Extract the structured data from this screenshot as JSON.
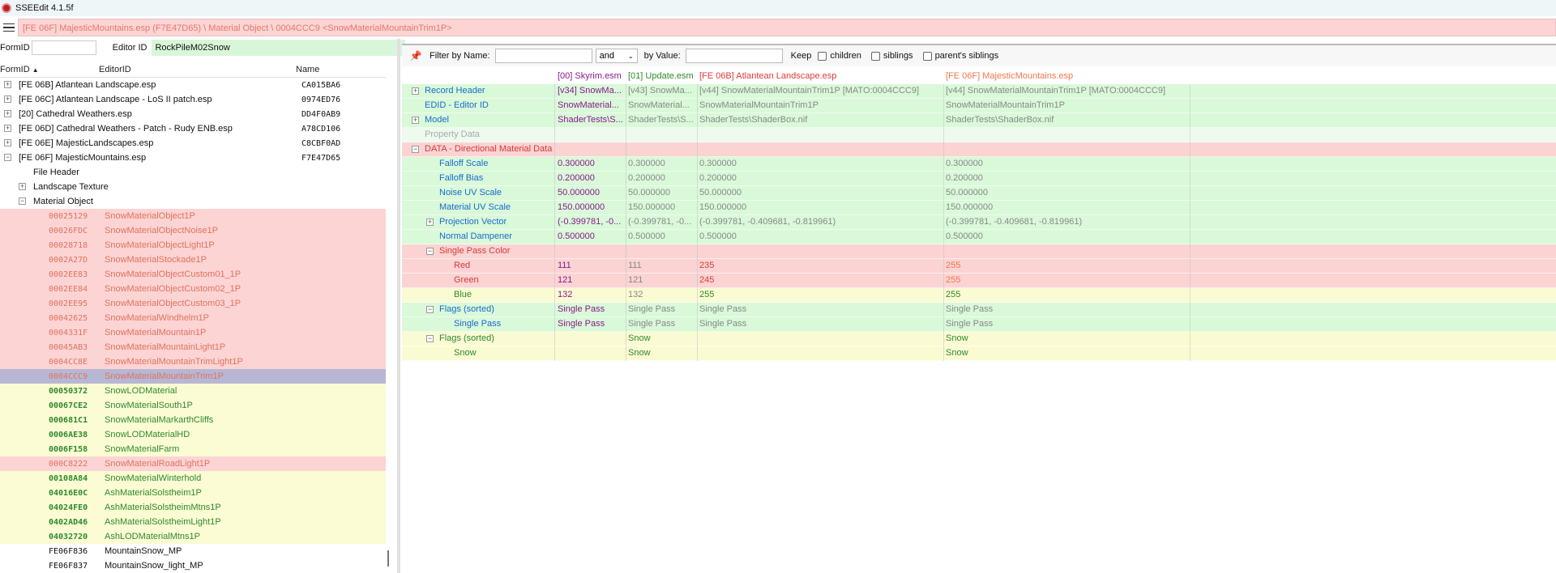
{
  "window": {
    "title": "SSEEdit 4.1.5f"
  },
  "path": "[FE 06F] MajesticMountains.esp (F7E47D65) \\ Material Object \\ 0004CCC9 <SnowMaterialMountainTrim1P>",
  "left": {
    "formid_label": "FormID",
    "editorid_label": "Editor ID",
    "editorid_value": "RockPileM02Snow",
    "headers": {
      "formid": "FormID",
      "editorid": "EditorID",
      "name": "Name",
      "sort_indicator": "▲"
    }
  },
  "plugins": [
    {
      "name": "[FE 06B] Atlantean Landscape.esp",
      "id": "CA015BA6"
    },
    {
      "name": "[FE 06C] Atlantean Landscape - LoS II patch.esp",
      "id": "0974ED76"
    },
    {
      "name": "[20] Cathedral Weathers.esp",
      "id": "DD4F0AB9"
    },
    {
      "name": "[FE 06D] Cathedral Weathers - Patch - Rudy ENB.esp",
      "id": "A78CD106"
    },
    {
      "name": "[FE 06E] MajesticLandscapes.esp",
      "id": "C8CBF0AD"
    },
    {
      "name": "[FE 06F] MajesticMountains.esp",
      "id": "F7E47D65"
    }
  ],
  "groups": {
    "file_header": "File Header",
    "landscape_texture": "Landscape Texture",
    "material_object": "Material Object"
  },
  "records": [
    {
      "formid": "00025129",
      "edid": "SnowMaterialObject1P",
      "state": "red"
    },
    {
      "formid": "00026FDC",
      "edid": "SnowMaterialObjectNoise1P",
      "state": "red"
    },
    {
      "formid": "00028718",
      "edid": "SnowMaterialObjectLight1P",
      "state": "red"
    },
    {
      "formid": "0002A27D",
      "edid": "SnowMaterialStockade1P",
      "state": "red"
    },
    {
      "formid": "0002EE83",
      "edid": "SnowMaterialObjectCustom01_1P",
      "state": "red"
    },
    {
      "formid": "0002EE84",
      "edid": "SnowMaterialObjectCustom02_1P",
      "state": "red"
    },
    {
      "formid": "0002EE95",
      "edid": "SnowMaterialObjectCustom03_1P",
      "state": "red"
    },
    {
      "formid": "00042625",
      "edid": "SnowMaterialWindhelm1P",
      "state": "red"
    },
    {
      "formid": "0004331F",
      "edid": "SnowMaterialMountain1P",
      "state": "red"
    },
    {
      "formid": "00045AB3",
      "edid": "SnowMaterialMountainLight1P",
      "state": "red"
    },
    {
      "formid": "0004CC8E",
      "edid": "SnowMaterialMountainTrimLight1P",
      "state": "red"
    },
    {
      "formid": "0004CCC9",
      "edid": "SnowMaterialMountainTrim1P",
      "state": "sel"
    },
    {
      "formid": "00050372",
      "edid": "SnowLODMaterial",
      "state": "yellow"
    },
    {
      "formid": "00067CE2",
      "edid": "SnowMaterialSouth1P",
      "state": "yellow"
    },
    {
      "formid": "000681C1",
      "edid": "SnowMaterialMarkarthCliffs",
      "state": "yellow"
    },
    {
      "formid": "0006AE38",
      "edid": "SnowLODMaterialHD",
      "state": "yellow"
    },
    {
      "formid": "0006F158",
      "edid": "SnowMaterialFarm",
      "state": "yellow"
    },
    {
      "formid": "000C8222",
      "edid": "SnowMaterialRoadLight1P",
      "state": "red"
    },
    {
      "formid": "00108A84",
      "edid": "SnowMaterialWinterhold",
      "state": "yellow"
    },
    {
      "formid": "04016E0C",
      "edid": "AshMaterialSolstheim1P",
      "state": "yellow"
    },
    {
      "formid": "04024FE0",
      "edid": "AshMaterialSolstheimMtns1P",
      "state": "yellow"
    },
    {
      "formid": "0402AD46",
      "edid": "AshMaterialSolstheimLight1P",
      "state": "yellow"
    },
    {
      "formid": "04032720",
      "edid": "AshLODMaterialMtns1P",
      "state": "yellow"
    },
    {
      "formid": "FE06F836",
      "edid": "MountainSnow_MP",
      "state": "white"
    },
    {
      "formid": "FE06F837",
      "edid": "MountainSnow_light_MP",
      "state": "white"
    }
  ],
  "filter": {
    "by_name_label": "Filter by Name:",
    "name_value": "",
    "combo_value": "and",
    "by_value_label": "by Value:",
    "value_value": "",
    "keep_label": "Keep",
    "children_label": "children",
    "siblings_label": "siblings",
    "parents_siblings_label": "parent's siblings"
  },
  "columns": [
    "[00] Skyrim.esm",
    "[01] Update.esm",
    "[FE 06B] Atlantean Landscape.esp",
    "[FE 06F] MajesticMountains.esp"
  ],
  "grid": [
    {
      "name": "Record Header",
      "exp": "+",
      "indent": 0,
      "bg": "green",
      "nc": "c-blue",
      "v": [
        "[v34] SnowMa...",
        "[v43] SnowMa...",
        "[v44] SnowMaterialMountainTrim1P [MATO:0004CCC9]",
        "[v44] SnowMaterialMountainTrim1P [MATO:0004CCC9]"
      ],
      "vc": [
        "c-purple",
        "c-gray",
        "c-gray",
        "c-gray"
      ]
    },
    {
      "name": "EDID - Editor ID",
      "exp": "",
      "indent": 0,
      "bg": "green",
      "nc": "c-blue",
      "v": [
        "SnowMaterial...",
        "SnowMaterial...",
        "SnowMaterialMountainTrim1P",
        "SnowMaterialMountainTrim1P"
      ],
      "vc": [
        "c-purple",
        "c-gray",
        "c-gray",
        "c-gray"
      ]
    },
    {
      "name": "Model",
      "exp": "+",
      "indent": 0,
      "bg": "green",
      "nc": "c-blue",
      "v": [
        "ShaderTests\\S...",
        "ShaderTests\\S...",
        "ShaderTests\\ShaderBox.nif",
        "ShaderTests\\ShaderBox.nif"
      ],
      "vc": [
        "c-purple",
        "c-gray",
        "c-gray",
        "c-gray"
      ]
    },
    {
      "name": "Property Data",
      "exp": "",
      "indent": 0,
      "bg": "pale",
      "nc": "c-lgray",
      "v": [
        "",
        "",
        "",
        ""
      ],
      "vc": [
        "c-gray",
        "c-gray",
        "c-gray",
        "c-gray"
      ]
    },
    {
      "name": "DATA - Directional Material Data",
      "exp": "−",
      "indent": 0,
      "bg": "red",
      "nc": "c-pink",
      "v": [
        "",
        "",
        "",
        ""
      ],
      "vc": [
        "c-gray",
        "c-gray",
        "c-gray",
        "c-gray"
      ]
    },
    {
      "name": "Falloff Scale",
      "exp": "",
      "indent": 1,
      "bg": "green",
      "nc": "c-blue",
      "v": [
        "0.300000",
        "0.300000",
        "0.300000",
        "0.300000"
      ],
      "vc": [
        "c-purple",
        "c-gray",
        "c-gray",
        "c-gray"
      ]
    },
    {
      "name": "Falloff Bias",
      "exp": "",
      "indent": 1,
      "bg": "green",
      "nc": "c-blue",
      "v": [
        "0.200000",
        "0.200000",
        "0.200000",
        "0.200000"
      ],
      "vc": [
        "c-purple",
        "c-gray",
        "c-gray",
        "c-gray"
      ]
    },
    {
      "name": "Noise UV Scale",
      "exp": "",
      "indent": 1,
      "bg": "green",
      "nc": "c-blue",
      "v": [
        "50.000000",
        "50.000000",
        "50.000000",
        "50.000000"
      ],
      "vc": [
        "c-purple",
        "c-gray",
        "c-gray",
        "c-gray"
      ]
    },
    {
      "name": "Material UV Scale",
      "exp": "",
      "indent": 1,
      "bg": "green",
      "nc": "c-blue",
      "v": [
        "150.000000",
        "150.000000",
        "150.000000",
        "150.000000"
      ],
      "vc": [
        "c-purple",
        "c-gray",
        "c-gray",
        "c-gray"
      ]
    },
    {
      "name": "Projection Vector",
      "exp": "+",
      "indent": 1,
      "bg": "green",
      "nc": "c-blue",
      "v": [
        "(-0.399781, -0...",
        "(-0.399781, -0...",
        "(-0.399781, -0.409681, -0.819961)",
        "(-0.399781, -0.409681, -0.819961)"
      ],
      "vc": [
        "c-purple",
        "c-gray",
        "c-gray",
        "c-gray"
      ]
    },
    {
      "name": "Normal Dampener",
      "exp": "",
      "indent": 1,
      "bg": "green",
      "nc": "c-blue",
      "v": [
        "0.500000",
        "0.500000",
        "0.500000",
        "0.500000"
      ],
      "vc": [
        "c-purple",
        "c-gray",
        "c-gray",
        "c-gray"
      ]
    },
    {
      "name": "Single Pass Color",
      "exp": "−",
      "indent": 1,
      "bg": "red",
      "nc": "c-pink",
      "v": [
        "",
        "",
        "",
        ""
      ],
      "vc": [
        "c-gray",
        "c-gray",
        "c-gray",
        "c-gray"
      ]
    },
    {
      "name": "Red",
      "exp": "",
      "indent": 2,
      "bg": "red",
      "nc": "c-pink",
      "v": [
        "111",
        "111",
        "235",
        "255"
      ],
      "vc": [
        "c-purple",
        "c-gray",
        "c-red",
        "c-orange"
      ]
    },
    {
      "name": "Green",
      "exp": "",
      "indent": 2,
      "bg": "red",
      "nc": "c-pink",
      "v": [
        "121",
        "121",
        "245",
        "255"
      ],
      "vc": [
        "c-purple",
        "c-gray",
        "c-red",
        "c-orange"
      ]
    },
    {
      "name": "Blue",
      "exp": "",
      "indent": 2,
      "bg": "yellow",
      "nc": "c-green",
      "v": [
        "132",
        "132",
        "255",
        "255"
      ],
      "vc": [
        "c-purple",
        "c-gray",
        "c-green",
        "c-green"
      ]
    },
    {
      "name": "Flags (sorted)",
      "exp": "−",
      "indent": 1,
      "bg": "green",
      "nc": "c-blue",
      "v": [
        "Single Pass",
        "Single Pass",
        "Single Pass",
        "Single Pass"
      ],
      "vc": [
        "c-purple",
        "c-gray",
        "c-gray",
        "c-gray"
      ]
    },
    {
      "name": "Single Pass",
      "exp": "",
      "indent": 2,
      "bg": "green",
      "nc": "c-blue",
      "v": [
        "Single Pass",
        "Single Pass",
        "Single Pass",
        "Single Pass"
      ],
      "vc": [
        "c-purple",
        "c-gray",
        "c-gray",
        "c-gray"
      ]
    },
    {
      "name": "Flags (sorted)",
      "exp": "−",
      "indent": 1,
      "bg": "yellow",
      "nc": "c-green",
      "v": [
        "",
        "Snow",
        "",
        "Snow"
      ],
      "vc": [
        "c-gray",
        "c-green",
        "c-gray",
        "c-green"
      ]
    },
    {
      "name": "Snow",
      "exp": "",
      "indent": 2,
      "bg": "yellow",
      "nc": "c-green",
      "v": [
        "",
        "Snow",
        "",
        "Snow"
      ],
      "vc": [
        "c-gray",
        "c-green",
        "c-gray",
        "c-green"
      ]
    }
  ]
}
